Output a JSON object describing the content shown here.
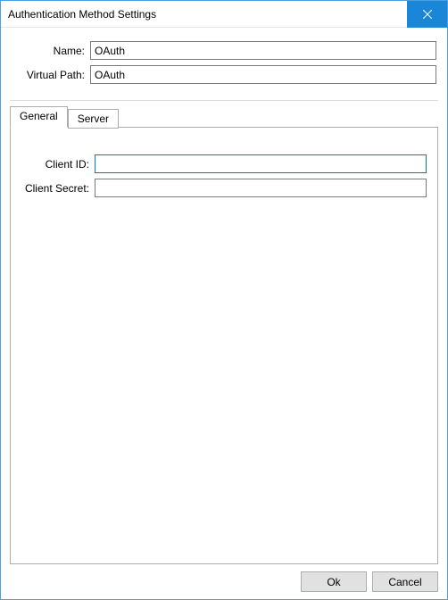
{
  "window": {
    "title": "Authentication Method Settings"
  },
  "top": {
    "name_label": "Name:",
    "name_value": "OAuth",
    "virtual_path_label": "Virtual Path:",
    "virtual_path_value": "OAuth"
  },
  "tabs": {
    "general": "General",
    "server": "Server"
  },
  "general": {
    "client_id_label": "Client ID:",
    "client_id_value": "",
    "client_secret_label": "Client Secret:",
    "client_secret_value": ""
  },
  "buttons": {
    "ok": "Ok",
    "cancel": "Cancel"
  }
}
